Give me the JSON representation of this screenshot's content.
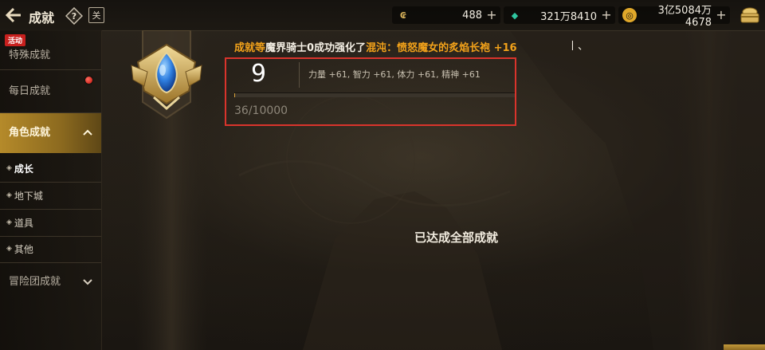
{
  "header": {
    "title": "成就",
    "help_icon": "question-icon",
    "book_icon_label": "关",
    "currencies": [
      {
        "name": "coin-icon",
        "glyph": "₢",
        "value": "488",
        "color": "#d8b25a"
      },
      {
        "name": "gem-icon",
        "glyph": "◆",
        "value": "321万8410",
        "color": "#2fc6a0"
      },
      {
        "name": "gold-icon",
        "glyph": "◎",
        "value": "3亿5084万4678",
        "color": "#e0a82a"
      }
    ],
    "plus_glyph": "+"
  },
  "sidebar": {
    "event_badge": "活动",
    "items": [
      {
        "label": "特殊成就"
      },
      {
        "label": "每日成就"
      },
      {
        "label": "角色成就"
      },
      {
        "label": "冒险团成就"
      }
    ],
    "sub_items": [
      {
        "label": "成长"
      },
      {
        "label": "地下城"
      },
      {
        "label": "道具"
      },
      {
        "label": "其他"
      }
    ],
    "sub_marker": "◈"
  },
  "notice": {
    "prefix": "成就等",
    "text1": "魔界骑士0成功强化了",
    "text2": "混沌：愤怒魔女的炙焰长袍 +16",
    "extra": "丨、"
  },
  "level": {
    "value": "9",
    "stats": "力量 +61, 智力 +61, 体力 +61, 精神 +61",
    "progress_text": "36/10000",
    "progress_fraction": 0.0036
  },
  "main": {
    "complete_message": "已达成全部成就"
  },
  "colors": {
    "accent_gold": "#b58a2a",
    "highlight_red": "#d9342c",
    "notice_orange": "#f2a21a"
  }
}
